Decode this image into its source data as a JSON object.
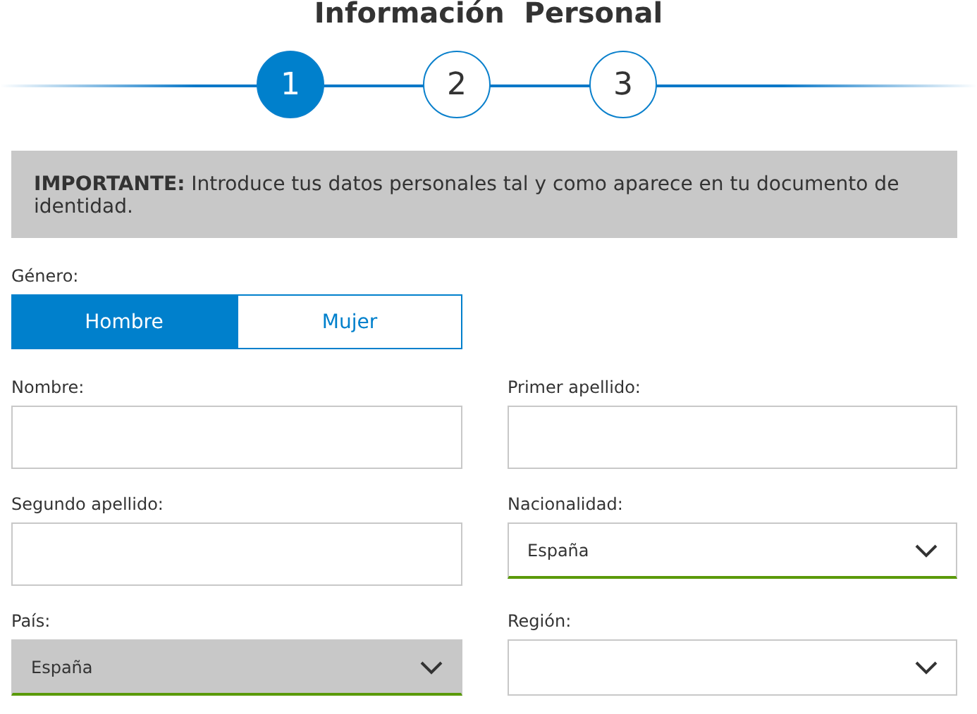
{
  "title": "Información  Personal",
  "steps": [
    {
      "label": "1",
      "selected": true
    },
    {
      "label": "2",
      "selected": false
    },
    {
      "label": "3",
      "selected": false
    }
  ],
  "notice": "**IMPORTANTE:** Introduce tus datos personales tal y como aparece en tu documento de identidad.",
  "gender": {
    "label": "Género:",
    "options": [
      {
        "label": "Hombre",
        "selected": true
      },
      {
        "label": "Mujer",
        "selected": false
      }
    ]
  },
  "fields": [
    {
      "kind": "text",
      "label": "Nombre:"
    },
    {
      "kind": "text",
      "label": "Primer apellido:"
    },
    {
      "kind": "text",
      "label": "Segundo apellido:"
    },
    {
      "kind": "select",
      "label": "Nacionalidad:",
      "value": "España",
      "disabled": false,
      "valid": true
    },
    {
      "kind": "select",
      "label": "País:",
      "value": "España",
      "disabled": true,
      "valid": true
    },
    {
      "kind": "select",
      "label": "Región:",
      "disabled": false,
      "valid": false
    }
  ]
}
